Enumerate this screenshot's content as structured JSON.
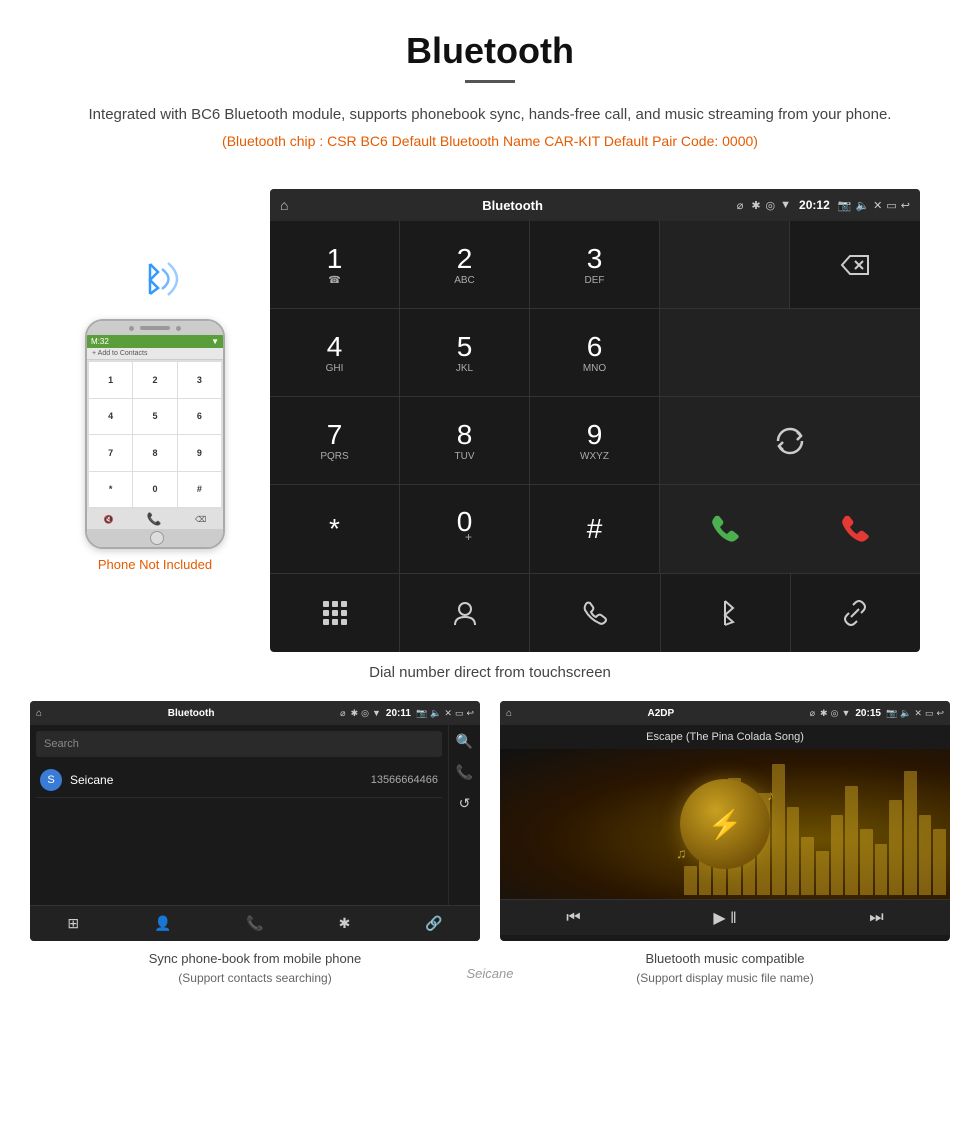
{
  "header": {
    "title": "Bluetooth",
    "description": "Integrated with BC6 Bluetooth module, supports phonebook sync, hands-free call, and music streaming from your phone.",
    "specs": "(Bluetooth chip : CSR BC6   Default Bluetooth Name CAR-KIT    Default Pair Code: 0000)"
  },
  "phone_mockup": {
    "not_included": "Phone Not Included",
    "keys": [
      "1",
      "2",
      "3",
      "4",
      "5",
      "6",
      "7",
      "8",
      "9",
      "*",
      "0",
      "+",
      "#"
    ]
  },
  "dial_screen": {
    "status_bar": {
      "home_icon": "⌂",
      "title": "Bluetooth",
      "usb_icon": "⌀",
      "time": "20:12"
    },
    "keys": [
      {
        "num": "1",
        "sub": "☎"
      },
      {
        "num": "2",
        "sub": "ABC"
      },
      {
        "num": "3",
        "sub": "DEF"
      },
      {
        "num": "4",
        "sub": "GHI"
      },
      {
        "num": "5",
        "sub": "JKL"
      },
      {
        "num": "6",
        "sub": "MNO"
      },
      {
        "num": "7",
        "sub": "PQRS"
      },
      {
        "num": "8",
        "sub": "TUV"
      },
      {
        "num": "9",
        "sub": "WXYZ"
      },
      {
        "num": "*",
        "sub": ""
      },
      {
        "num": "0",
        "sub": "+"
      },
      {
        "num": "#",
        "sub": ""
      }
    ],
    "bottom_icons": [
      "⊞",
      "👤",
      "📞",
      "✱",
      "🔗"
    ],
    "caption": "Dial number direct from touchscreen"
  },
  "phonebook_screen": {
    "status_bar": {
      "title": "Bluetooth",
      "time": "20:11"
    },
    "search_placeholder": "Search",
    "contacts": [
      {
        "letter": "S",
        "name": "Seicane",
        "number": "13566664466"
      }
    ],
    "caption": "Sync phone-book from mobile phone",
    "caption_sub": "(Support contacts searching)"
  },
  "music_screen": {
    "status_bar": {
      "title": "A2DP",
      "time": "20:15"
    },
    "song_title": "Escape (The Pina Colada Song)",
    "caption": "Bluetooth music compatible",
    "caption_sub": "(Support display music file name)"
  },
  "watermark": "Seicane"
}
